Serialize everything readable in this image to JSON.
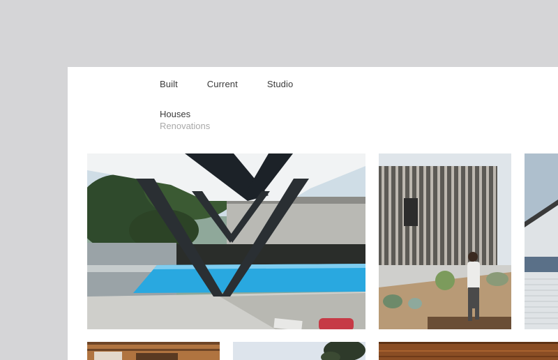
{
  "nav": {
    "items": [
      {
        "label": "Built"
      },
      {
        "label": "Current"
      },
      {
        "label": "Studio"
      }
    ]
  },
  "subnav": {
    "items": [
      {
        "label": "Houses",
        "state": "active"
      },
      {
        "label": "Renovations",
        "state": "inactive"
      }
    ]
  },
  "gallery": {
    "tiles": [
      {
        "subject": "v-column-pool-house"
      },
      {
        "subject": "timber-screen-house"
      },
      {
        "subject": "weatherboard-house"
      },
      {
        "subject": "timber-pergola"
      },
      {
        "subject": "tree-sky"
      },
      {
        "subject": "timber-ceiling"
      }
    ]
  },
  "colors": {
    "backdrop": "#d5d5d7",
    "page": "#ffffff",
    "nav_text": "#3a3a3a",
    "muted_text": "#a9a9a9",
    "pool": "#29a8e0"
  }
}
